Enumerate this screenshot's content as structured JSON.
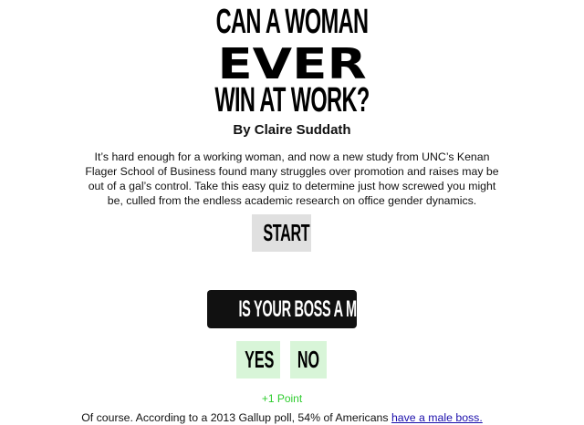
{
  "header": {
    "title_line1": "CAN A WOMAN",
    "title_line2": "EVER",
    "title_line3": "WIN AT WORK?",
    "byline": "By Claire Suddath"
  },
  "intro": {
    "text": "It’s hard enough for a working woman, and now a new study from UNC’s Kenan Flager School of Business found many struggles over promotion and raises may be out of a gal’s control. Take this easy quiz to determine just how screwed you might be, culled from the endless academic research on office gender dynamics."
  },
  "quiz": {
    "start_label": "START",
    "question": "IS YOUR BOSS A MAN?",
    "yes_label": "YES",
    "no_label": "NO",
    "points": "+1 Point",
    "explanation_text": "Of course. According to a 2013 Gallup poll, 54% of Americans ",
    "explanation_link": "have a male boss."
  },
  "colors": {
    "start_bg": "#e0e0e0",
    "banner_bg": "#111111",
    "answer_bg": "#d8f5d8",
    "points_text": "#2ecc2e",
    "link": "#1a0dab"
  }
}
